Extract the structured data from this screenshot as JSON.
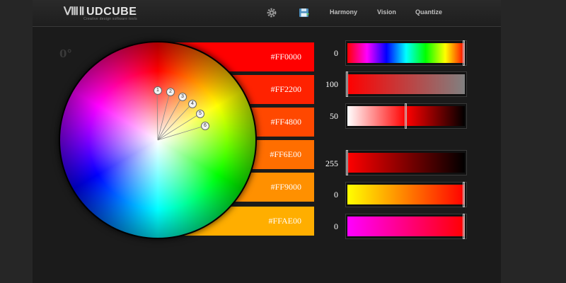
{
  "header": {
    "logo_text": "UDCUBE",
    "tagline": "Creative design software tools",
    "nav": [
      {
        "label": "Harmony"
      },
      {
        "label": "Vision"
      },
      {
        "label": "Quantize"
      }
    ]
  },
  "wheel": {
    "angle_label": "0°",
    "handles": [
      "1",
      "2",
      "3",
      "4",
      "5",
      "6"
    ]
  },
  "swatches": [
    {
      "hex": "#FF0000",
      "color": "#ff0000"
    },
    {
      "hex": "#FF2200",
      "color": "#ff2200"
    },
    {
      "hex": "#FF4800",
      "color": "#ff4800"
    },
    {
      "hex": "#FF6E00",
      "color": "#ff6e00"
    },
    {
      "hex": "#FF9000",
      "color": "#ff9000"
    },
    {
      "hex": "#FFAE00",
      "color": "#ffae00"
    }
  ],
  "sliders": [
    {
      "label": "0",
      "name": "hue",
      "value": 0
    },
    {
      "label": "100",
      "name": "saturation",
      "value": 100
    },
    {
      "label": "50",
      "name": "lightness",
      "value": 50
    },
    {
      "label": "255",
      "name": "red",
      "value": 255
    },
    {
      "label": "0",
      "name": "green",
      "value": 0
    },
    {
      "label": "0",
      "name": "blue",
      "value": 0
    }
  ]
}
